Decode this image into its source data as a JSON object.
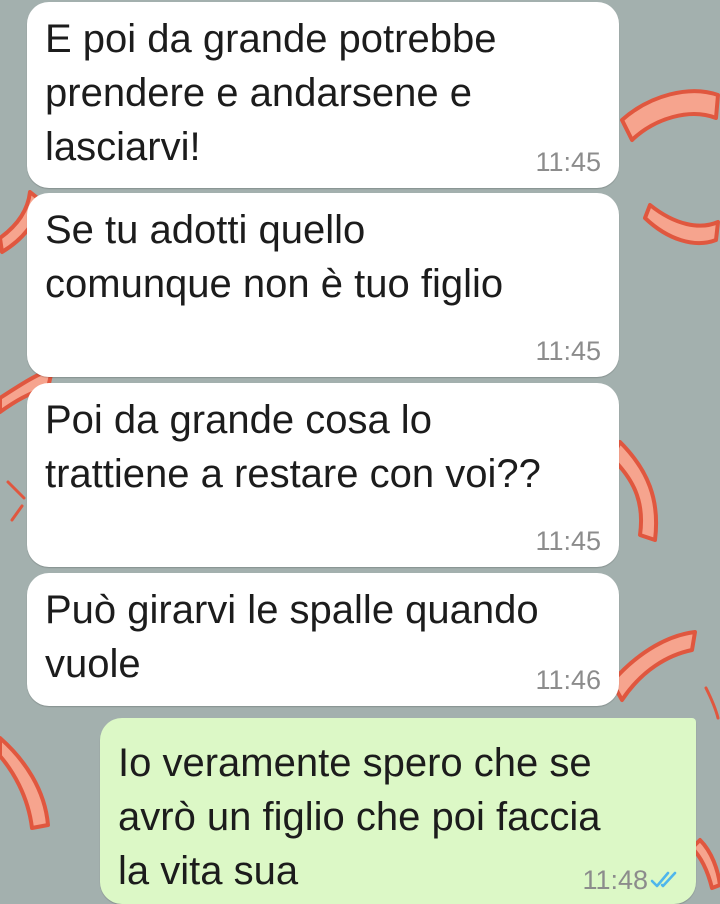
{
  "chat": {
    "messages": [
      {
        "direction": "incoming",
        "text": "E poi da grande potrebbe\nprendere e andarsene e\nlasciarvi!",
        "time": "11:45"
      },
      {
        "direction": "incoming",
        "text": "Se tu adotti quello\ncomunque non è tuo figlio",
        "time": "11:45"
      },
      {
        "direction": "incoming",
        "text": "Poi da grande cosa lo\ntrattiene a restare con voi??",
        "time": "11:45"
      },
      {
        "direction": "incoming",
        "text": "Può girarvi le spalle quando\nvuole",
        "time": "11:46"
      },
      {
        "direction": "outgoing",
        "text": "Io veramente spero che se\navrò un figlio che poi faccia\nla vita sua",
        "time": "11:48",
        "status_icon": "double-check-read-icon"
      }
    ]
  },
  "colors": {
    "wallpaper": "#a3b0ae",
    "incoming_bubble": "#ffffff",
    "outgoing_bubble": "#dcf8c6",
    "read_ticks": "#4fb6ec"
  }
}
